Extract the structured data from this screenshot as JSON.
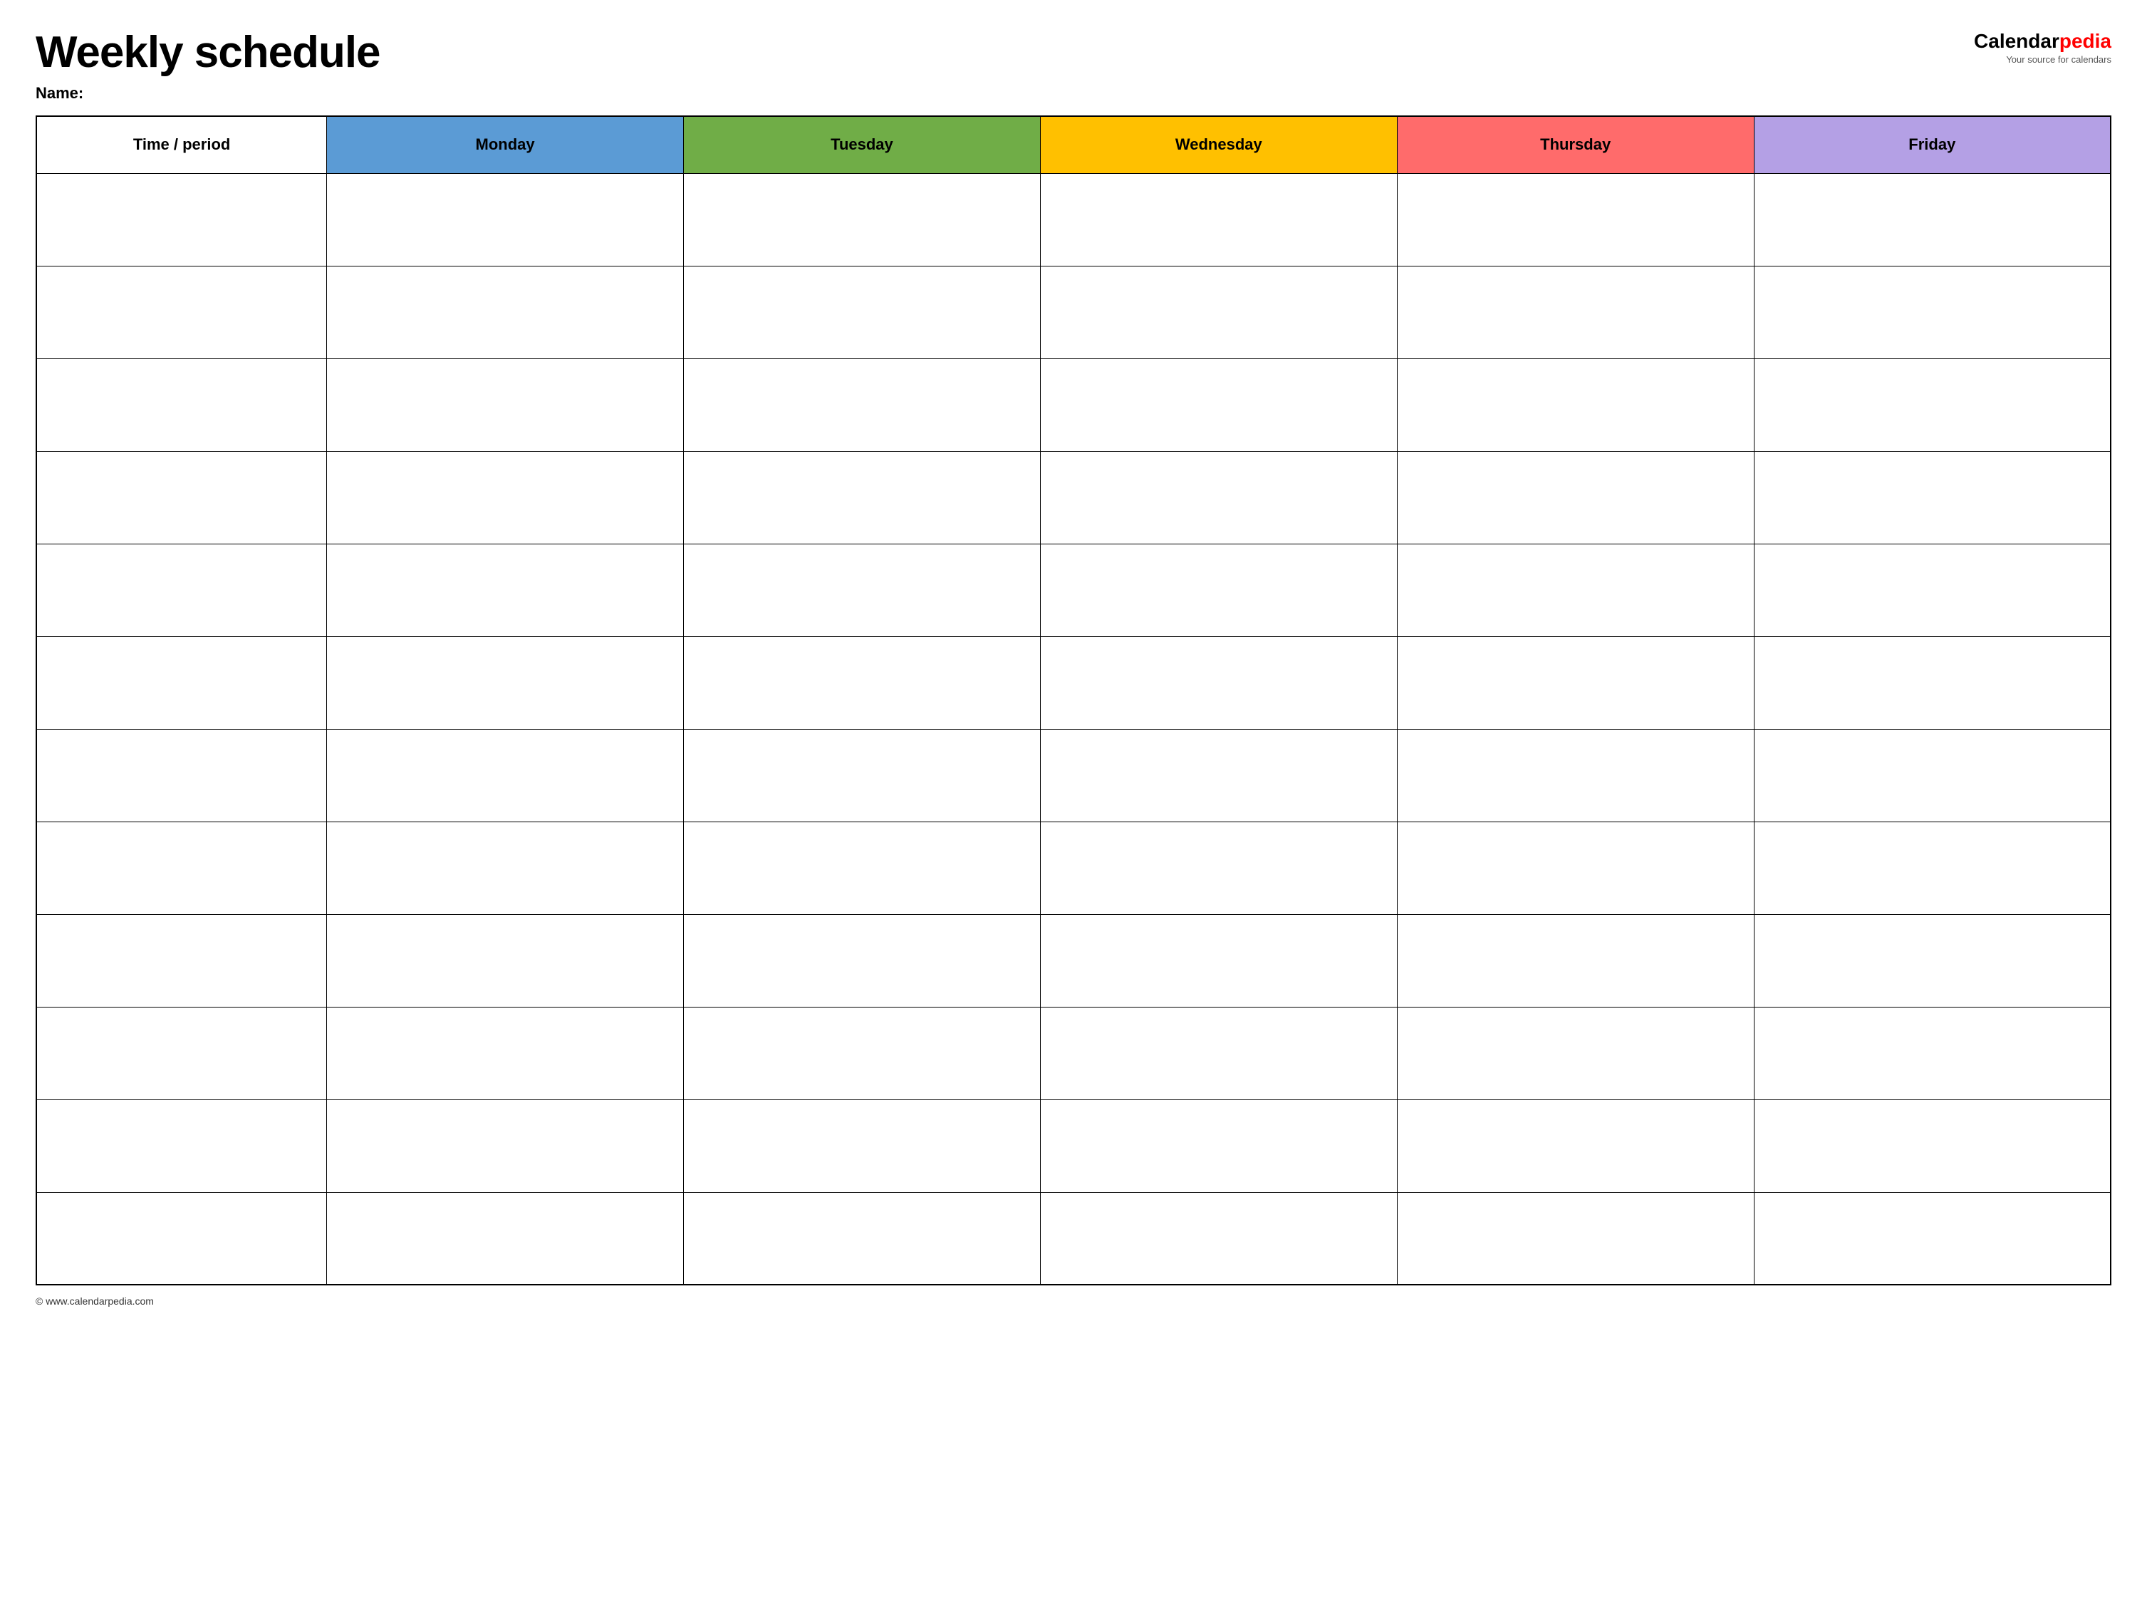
{
  "header": {
    "title": "Weekly schedule",
    "name_label": "Name:",
    "logo_calendar": "Calendar",
    "logo_pedia": "pedia",
    "logo_tagline": "Your source for calendars"
  },
  "table": {
    "columns": [
      {
        "label": "Time / period",
        "class": "col-time"
      },
      {
        "label": "Monday",
        "class": "col-monday"
      },
      {
        "label": "Tuesday",
        "class": "col-tuesday"
      },
      {
        "label": "Wednesday",
        "class": "col-wednesday"
      },
      {
        "label": "Thursday",
        "class": "col-thursday"
      },
      {
        "label": "Friday",
        "class": "col-friday"
      }
    ],
    "row_count": 12
  },
  "footer": {
    "url": "© www.calendarpedia.com"
  }
}
